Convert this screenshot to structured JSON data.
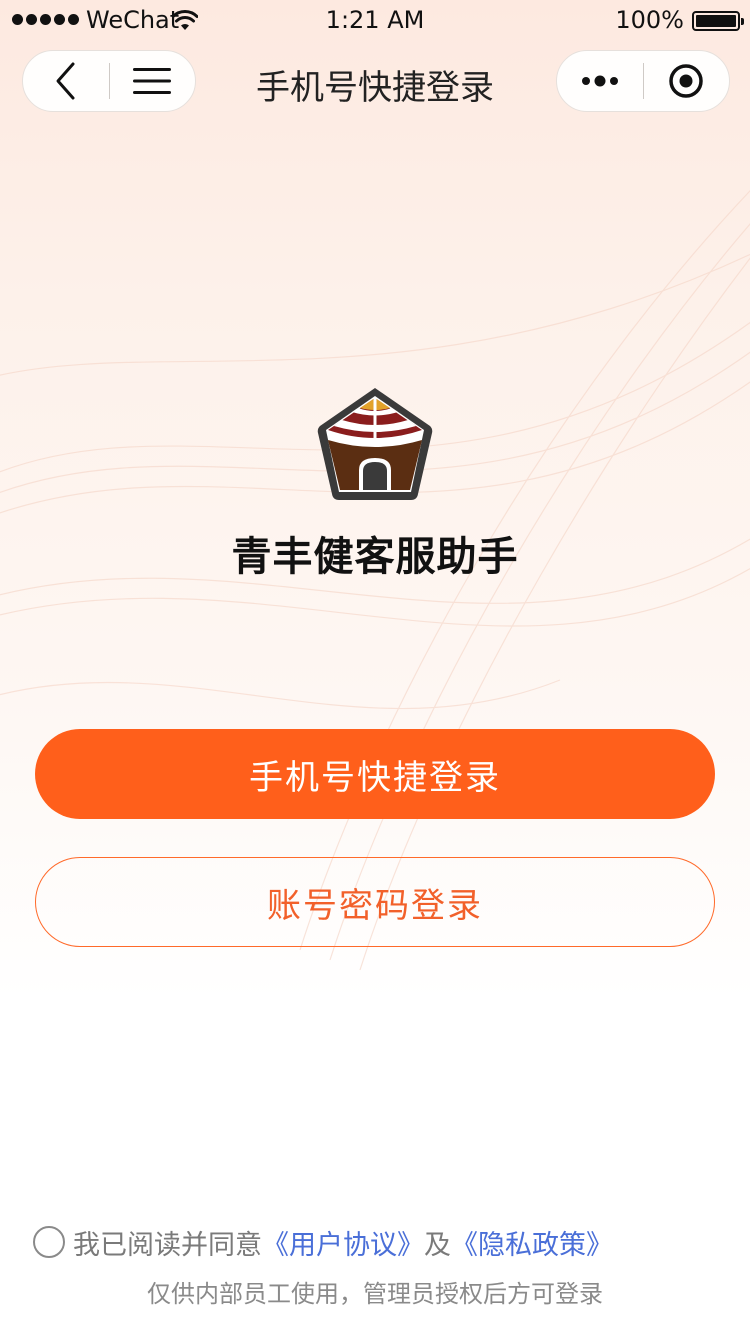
{
  "status_bar": {
    "carrier": "WeChat",
    "time": "1:21 AM",
    "battery": "100%",
    "battery_level": 1.0,
    "icons": [
      "signal-dots-icon",
      "wifi-icon",
      "battery-icon"
    ]
  },
  "nav": {
    "title": "手机号快捷登录",
    "left_icons": [
      "back-icon",
      "menu-icon"
    ],
    "right_icons": [
      "more-icon",
      "target-icon"
    ]
  },
  "brand": {
    "app_name": "青丰健客服助手",
    "logo_icon": "yurt-logo-icon"
  },
  "actions": {
    "phone_login": "手机号快捷登录",
    "account_login": "账号密码登录"
  },
  "agreement": {
    "prefix": "我已阅读并同意",
    "user_agreement": "《用户协议》",
    "conjunction": "及",
    "privacy_policy": "《隐私政策》",
    "checked": false,
    "notice": "仅供内部员工使用，管理员授权后方可登录"
  },
  "colors": {
    "accent": "#ff5f1b",
    "link": "#4a6fd8",
    "muted_text": "#7a7a7a"
  }
}
